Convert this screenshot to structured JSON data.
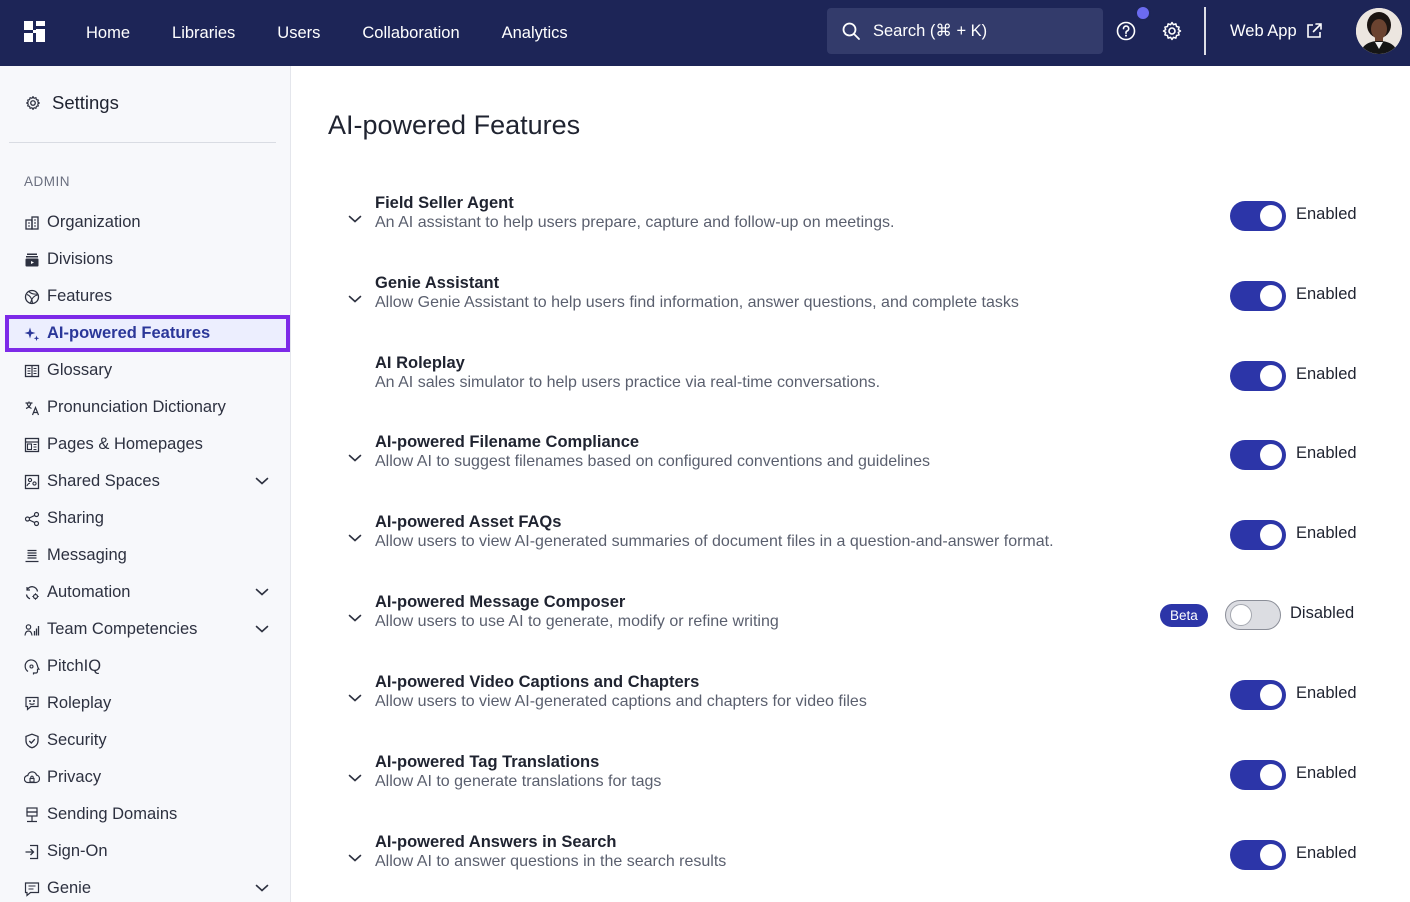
{
  "nav": {
    "items": [
      "Home",
      "Libraries",
      "Users",
      "Collaboration",
      "Analytics"
    ],
    "search_placeholder": "Search (⌘ + K)",
    "webapp_label": "Web App"
  },
  "sidebar": {
    "title": "Settings",
    "section": "ADMIN",
    "items": [
      {
        "label": "Organization",
        "icon": "building-icon"
      },
      {
        "label": "Divisions",
        "icon": "divisions-icon"
      },
      {
        "label": "Features",
        "icon": "features-icon"
      },
      {
        "label": "AI-powered Features",
        "icon": "sparkle-icon"
      },
      {
        "label": "Glossary",
        "icon": "glossary-icon"
      },
      {
        "label": "Pronunciation Dictionary",
        "icon": "translate-icon"
      },
      {
        "label": "Pages & Homepages",
        "icon": "layout-icon"
      },
      {
        "label": "Shared Spaces",
        "icon": "shared-spaces-icon"
      },
      {
        "label": "Sharing",
        "icon": "share-icon"
      },
      {
        "label": "Messaging",
        "icon": "messaging-icon"
      },
      {
        "label": "Automation",
        "icon": "automation-icon"
      },
      {
        "label": "Team Competencies",
        "icon": "team-icon"
      },
      {
        "label": "PitchIQ",
        "icon": "pitchiq-icon"
      },
      {
        "label": "Roleplay",
        "icon": "roleplay-icon"
      },
      {
        "label": "Security",
        "icon": "shield-icon"
      },
      {
        "label": "Privacy",
        "icon": "privacy-icon"
      },
      {
        "label": "Sending Domains",
        "icon": "server-icon"
      },
      {
        "label": "Sign-On",
        "icon": "sign-on-icon"
      },
      {
        "label": "Genie",
        "icon": "genie-icon"
      }
    ]
  },
  "main": {
    "title": "AI-powered Features",
    "features": [
      {
        "title": "Field Seller Agent",
        "description": "An AI assistant to help users prepare, capture and follow-up on meetings.",
        "status": "Enabled"
      },
      {
        "title": "Genie Assistant",
        "description": "Allow Genie Assistant to help users find information, answer questions, and complete tasks",
        "status": "Enabled"
      },
      {
        "title": "AI Roleplay",
        "description": "An AI sales simulator to help users practice via real-time conversations.",
        "status": "Enabled"
      },
      {
        "title": "AI-powered Filename Compliance",
        "description": "Allow AI to suggest filenames based on configured conventions and guidelines",
        "status": "Enabled"
      },
      {
        "title": "AI-powered Asset FAQs",
        "description": "Allow users to view AI-generated summaries of document files in a question-and-answer format.",
        "status": "Enabled"
      },
      {
        "title": "AI-powered Message Composer",
        "description": "Allow users to use AI to generate, modify or refine writing",
        "status": "Disabled",
        "badge": "Beta"
      },
      {
        "title": "AI-powered Video Captions and Chapters",
        "description": "Allow users to view AI-generated captions and chapters for video files",
        "status": "Enabled"
      },
      {
        "title": "AI-powered Tag Translations",
        "description": "Allow AI to generate translations for tags",
        "status": "Enabled"
      },
      {
        "title": "AI-powered Answers in Search",
        "description": "Allow AI to answer questions in the search results",
        "status": "Enabled"
      }
    ]
  },
  "colors": {
    "nav_bg": "#1d2557",
    "accent": "#2c35a8",
    "active_outline": "#7d2ae8",
    "notification": "#6b6bf0"
  }
}
